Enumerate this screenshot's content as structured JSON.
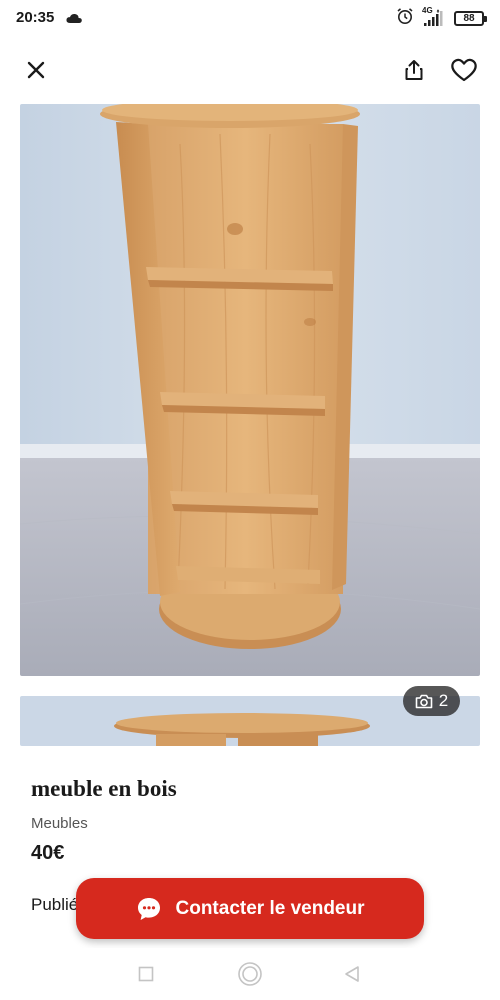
{
  "status_bar": {
    "time": "20:35",
    "network": "4G",
    "battery": "88",
    "icons": [
      "cloud-icon",
      "alarm-icon",
      "signal-icon",
      "battery-icon"
    ]
  },
  "header": {
    "icons": [
      "close-icon",
      "share-icon",
      "heart-icon"
    ]
  },
  "gallery": {
    "photo_count": "2",
    "main_photo": "wooden-shelf-photo",
    "camera_icon": "camera-icon"
  },
  "ad": {
    "title": "meuble en bois",
    "category": "Meubles",
    "price": "40€",
    "published_prefix": "Publié"
  },
  "contact": {
    "label": "Contacter le vendeur",
    "icon": "chat-bubble-icon",
    "color": "#d6291e"
  },
  "navigation": {
    "icons": [
      "recent-apps-icon",
      "home-icon",
      "back-icon"
    ]
  }
}
